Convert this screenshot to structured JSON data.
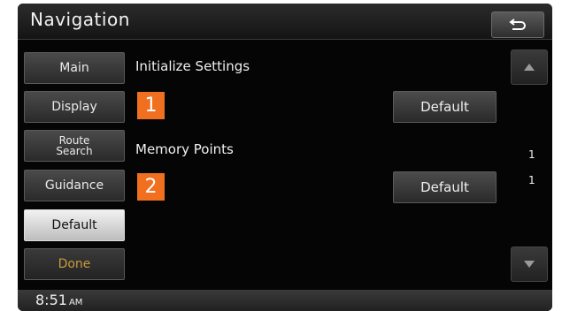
{
  "header": {
    "title": "Navigation",
    "back_icon": "back-arrow-icon"
  },
  "sidebar": {
    "items": [
      {
        "label": "Main"
      },
      {
        "label": "Display"
      },
      {
        "label_line1": "Route",
        "label_line2": "Search"
      },
      {
        "label": "Guidance"
      },
      {
        "label": "Default",
        "selected": true
      },
      {
        "label": "Done"
      }
    ]
  },
  "content": {
    "sections": [
      {
        "title": "Initialize Settings",
        "marker": "1",
        "button_label": "Default"
      },
      {
        "title": "Memory Points",
        "marker": "2",
        "button_label": "Default"
      }
    ]
  },
  "scroll": {
    "page_current": "1",
    "page_total": "1"
  },
  "status": {
    "time": "8:51",
    "ampm": "AM"
  },
  "colors": {
    "marker": "#f07020",
    "done_text": "#c89a3a",
    "selected_bg": "#e6e6e6"
  }
}
